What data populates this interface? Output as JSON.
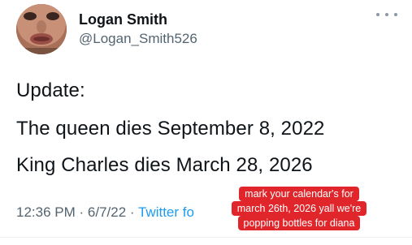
{
  "author": {
    "name": "Logan Smith",
    "handle": "@Logan_Smith526"
  },
  "tweet": {
    "lines": [
      "Update:",
      "The queen dies September 8, 2022",
      "King Charles dies March 28, 2026"
    ],
    "time": "12:36 PM",
    "date": "6/7/22",
    "source": "Twitter fo"
  },
  "caption": {
    "lines": [
      "mark your calendar's for",
      "march 26th, 2026 yall we're",
      "popping bottles for diana"
    ]
  },
  "icons": {
    "more": "more-options-icon"
  },
  "colors": {
    "handle_gray": "#536471",
    "link_blue": "#1d9bf0",
    "caption_red": "#e0262a"
  }
}
